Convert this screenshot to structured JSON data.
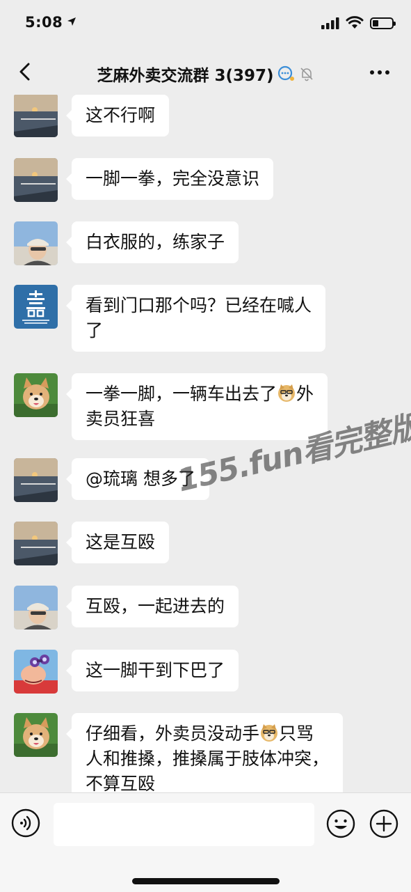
{
  "status_bar": {
    "time": "5:08"
  },
  "header": {
    "title": "芝麻外卖交流群 3(397)"
  },
  "messages": [
    {
      "avatar": "sunset-sea-avatar",
      "lines": [
        "这不行啊"
      ]
    },
    {
      "avatar": "sunset-sea-avatar",
      "lines": [
        "一脚一拳，完全没意识"
      ]
    },
    {
      "avatar": "man-cap-avatar",
      "lines": [
        "白衣服的，练家子"
      ]
    },
    {
      "avatar": "blue-character-avatar",
      "lines": [
        "看到门口那个吗？已经在喊人",
        "了"
      ]
    },
    {
      "avatar": "shiba-dog-avatar",
      "lines": [
        "一拳一脚，一辆车出去了",
        "外",
        "卖员狂喜"
      ]
    },
    {
      "avatar": "sunset-sea-avatar",
      "lines": [
        "@琉璃 想多了"
      ]
    },
    {
      "avatar": "sunset-sea-avatar",
      "lines": [
        "这是互殴"
      ]
    },
    {
      "avatar": "man-cap-avatar",
      "lines": [
        "互殴，一起进去的"
      ]
    },
    {
      "avatar": "cartoon-binoculars-avatar",
      "lines": [
        "这一脚干到下巴了"
      ]
    },
    {
      "avatar": "shiba-dog-avatar",
      "lines": [
        "仔细看，外卖员没动手",
        "只骂",
        "人和推搡，推搡属于肢体冲突，",
        "不算互殴"
      ]
    }
  ],
  "watermark": "155.fun看完整版",
  "input": {
    "value": ""
  },
  "colors": {
    "background": "#ededed",
    "bubble": "#ffffff"
  }
}
